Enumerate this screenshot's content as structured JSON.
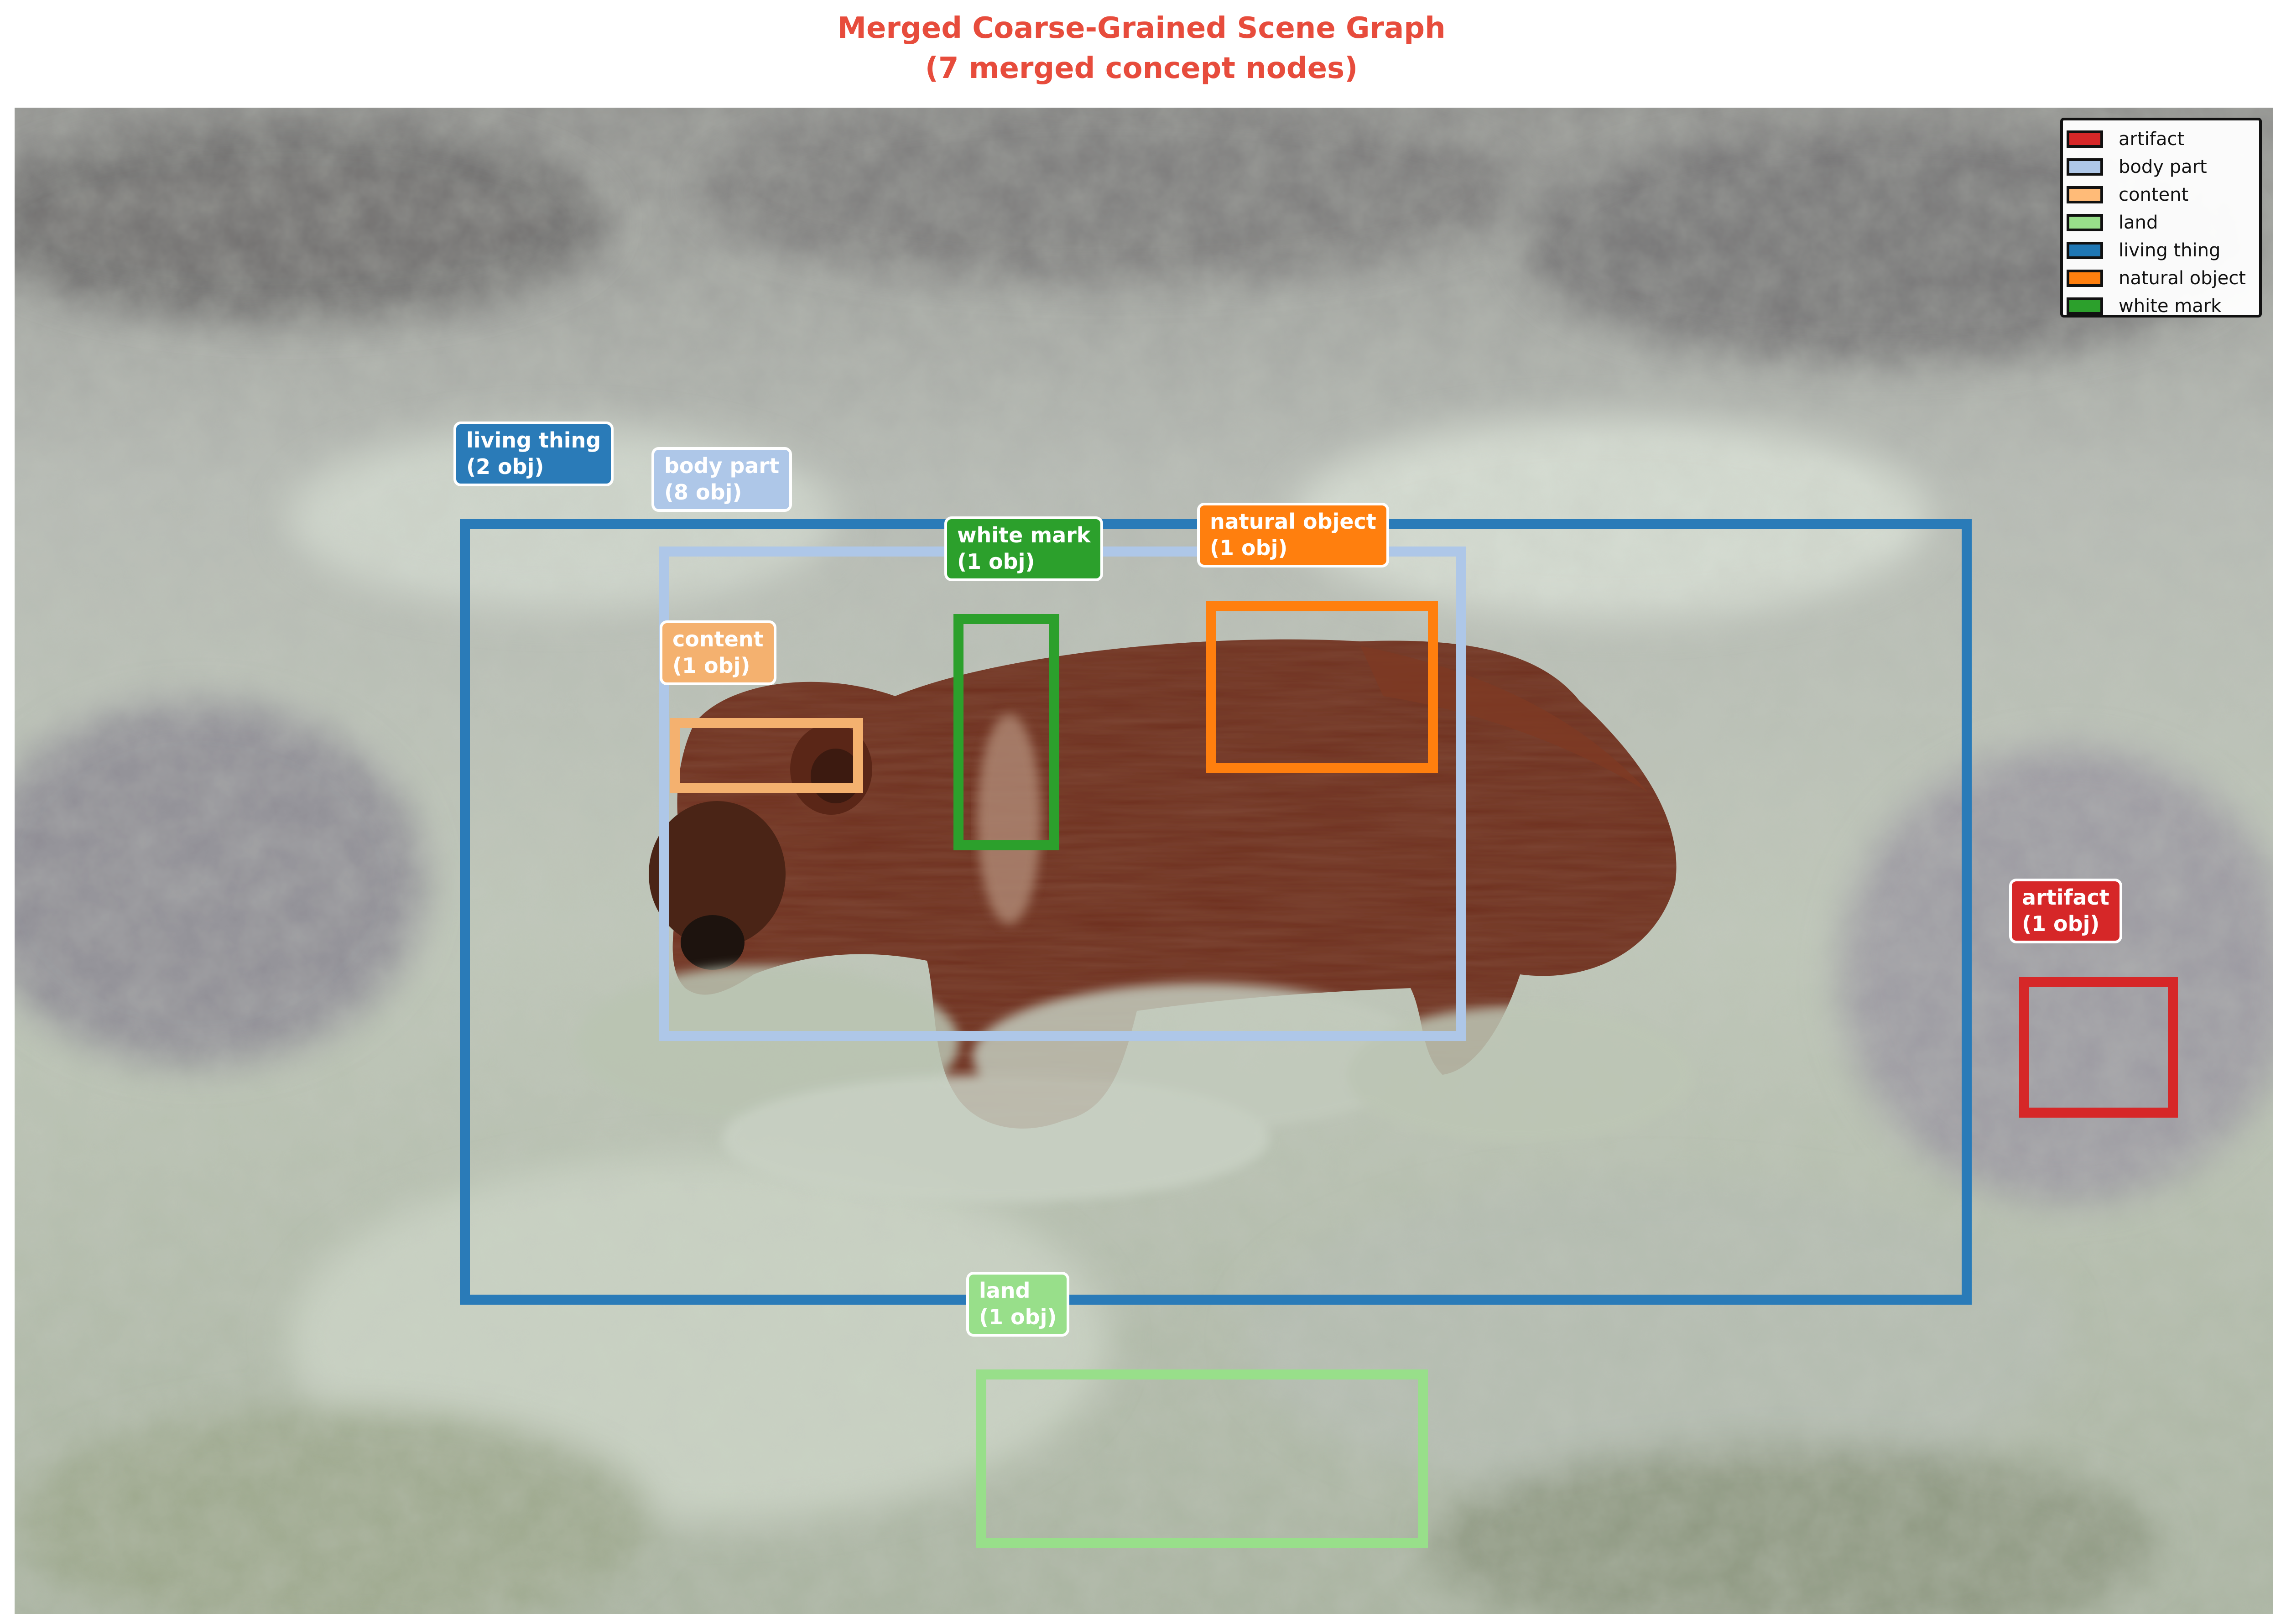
{
  "title": {
    "line1": "Merged Coarse-Grained Scene Graph",
    "line2": "(7 merged concept nodes)"
  },
  "image_description_colors": {
    "vegetation": "#bcc4b7",
    "bear_fur": "#6b2f1d",
    "title_color": "#e74c3c"
  },
  "nodes": [
    {
      "id": "living-thing",
      "name": "living thing",
      "count": "(2 obj)",
      "color": "#2a7bb8",
      "text_color": "#ffffff"
    },
    {
      "id": "body-part",
      "name": "body part",
      "count": "(8 obj)",
      "color": "#aec7e8",
      "text_color": "#ffffff"
    },
    {
      "id": "white-mark",
      "name": "white mark",
      "count": "(1 obj)",
      "color": "#2ca02c",
      "text_color": "#ffffff"
    },
    {
      "id": "natural-object",
      "name": "natural object",
      "count": "(1 obj)",
      "color": "#ff7f0e",
      "text_color": "#ffffff"
    },
    {
      "id": "content",
      "name": "content",
      "count": "(1 obj)",
      "color": "#f4b16f",
      "text_color": "#ffffff"
    },
    {
      "id": "artifact",
      "name": "artifact",
      "count": "(1 obj)",
      "color": "#d62728",
      "text_color": "#ffffff"
    },
    {
      "id": "land",
      "name": "land",
      "count": "(1 obj)",
      "color": "#98df8a",
      "text_color": "#ffffff"
    }
  ],
  "legend": [
    {
      "label": "artifact",
      "color": "#d62728"
    },
    {
      "label": "body part",
      "color": "#aec7e8"
    },
    {
      "label": "content",
      "color": "#ffbb78"
    },
    {
      "label": "land",
      "color": "#98df8a"
    },
    {
      "label": "living thing",
      "color": "#1f77b4"
    },
    {
      "label": "natural object",
      "color": "#ff7f0e"
    },
    {
      "label": "white mark",
      "color": "#2ca02c"
    }
  ]
}
